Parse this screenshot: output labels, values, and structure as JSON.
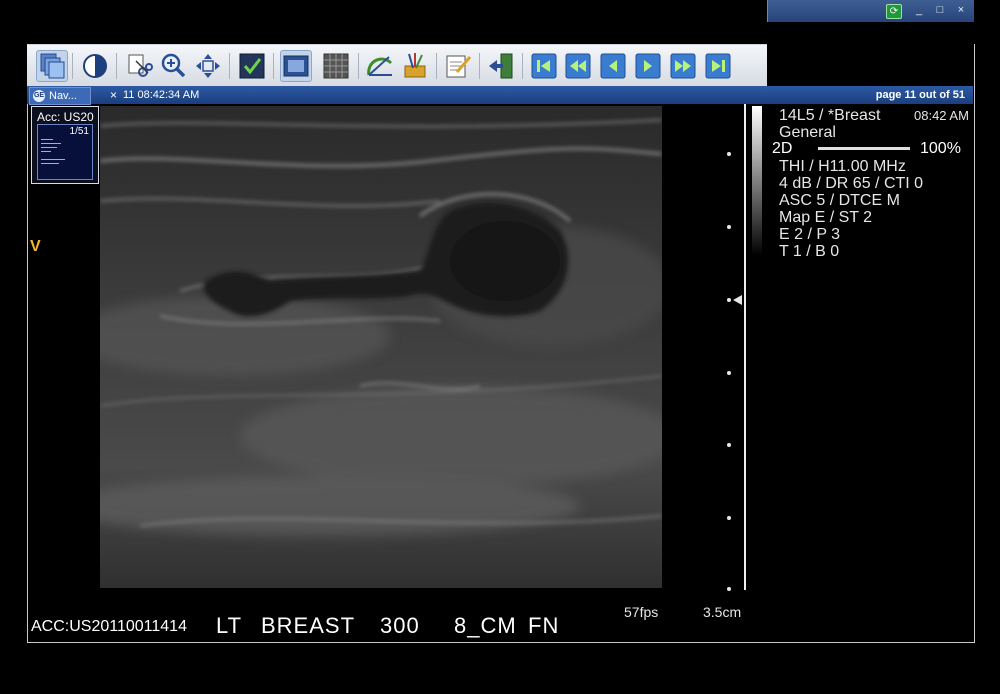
{
  "window": {
    "controls": {
      "restore": "⟳",
      "minimize": "_",
      "maximize": "□",
      "close": "×"
    }
  },
  "toolbar": {
    "buttons": [
      {
        "name": "series-layout-button",
        "icon": "stacked-pages-icon"
      },
      {
        "name": "window-level-button",
        "icon": "contrast-half-circle-icon"
      },
      {
        "name": "annotate-cut-button",
        "icon": "scissors-doc-icon"
      },
      {
        "name": "zoom-button",
        "icon": "magnifier-icon"
      },
      {
        "name": "pan-button",
        "icon": "move-arrows-icon"
      },
      {
        "name": "select-button",
        "icon": "checkmark-box-icon"
      },
      {
        "name": "single-view-button",
        "icon": "single-frame-icon"
      },
      {
        "name": "grid-view-button",
        "icon": "grid-frame-icon"
      },
      {
        "name": "measure-angle-button",
        "icon": "protractor-icon"
      },
      {
        "name": "tools-button",
        "icon": "tools-basket-icon"
      },
      {
        "name": "report-button",
        "icon": "pencil-notepad-icon"
      },
      {
        "name": "exit-button",
        "icon": "exit-door-icon"
      },
      {
        "name": "first-frame-button",
        "icon": "skip-first-icon"
      },
      {
        "name": "fast-rewind-button",
        "icon": "fast-rewind-icon"
      },
      {
        "name": "prev-frame-button",
        "icon": "step-back-icon"
      },
      {
        "name": "next-frame-button",
        "icon": "step-forward-icon"
      },
      {
        "name": "fast-forward-button",
        "icon": "fast-forward-icon"
      },
      {
        "name": "last-frame-button",
        "icon": "skip-last-icon"
      }
    ]
  },
  "statusbar": {
    "tab_label": "Nav...",
    "tab_close": "×",
    "timestamp": "11 08:42:34 AM",
    "page": "page 11 out of 51"
  },
  "thumbnail": {
    "accession": "Acc: US20",
    "page": "1/51"
  },
  "marker": "V",
  "scan_params": {
    "probe": "14L5 / *Breast",
    "preset": "General",
    "time": "08:42 AM",
    "mode": "2D",
    "mode_percent": "100%",
    "lines": [
      "THI / H11.00 MHz",
      "4 dB / DR 65 / CTI 0",
      "ASC 5 / DTCE M",
      "Map E / ST 2",
      "E 2 / P 3",
      "T 1 / B 0"
    ]
  },
  "bottom": {
    "fps": "57fps",
    "depth": "3.5cm",
    "accession": "ACC:US20110011414",
    "annotations": [
      "LT",
      "BREAST",
      "300",
      "8_CM",
      "FN"
    ]
  },
  "colors": {
    "accent_blue": "#1b3e7e",
    "marker_yellow": "#f2b72b"
  }
}
